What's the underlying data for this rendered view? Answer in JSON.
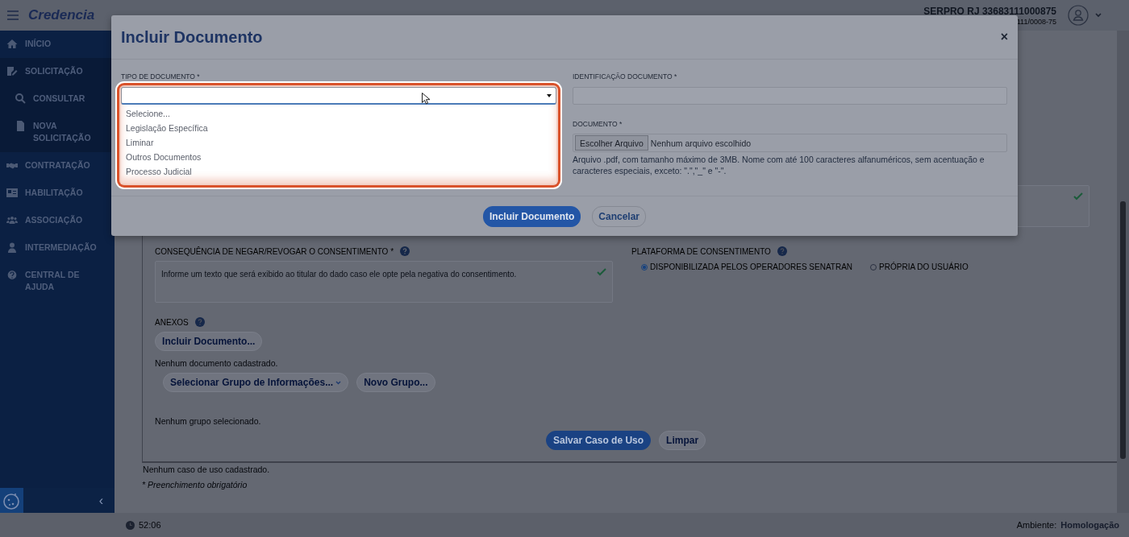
{
  "header": {
    "logo": "Credencia",
    "user_name": "SERPRO RJ 33683111000875",
    "user_sub": "111/0008-75"
  },
  "sidebar": {
    "items": [
      {
        "label": "INÍCIO",
        "expanded": false
      },
      {
        "label": "SOLICITAÇÃO",
        "expanded": true,
        "children": [
          {
            "label": "CONSULTAR"
          },
          {
            "label": "NOVA SOLICITAÇÃO"
          }
        ]
      },
      {
        "label": "CONTRATAÇÃO",
        "expanded": false
      },
      {
        "label": "HABILITAÇÃO",
        "expanded": false
      },
      {
        "label": "ASSOCIAÇÃO",
        "expanded": false
      },
      {
        "label": "INTERMEDIAÇÃO",
        "expanded": false
      },
      {
        "label": "CENTRAL DE AJUDA",
        "expanded": false
      }
    ],
    "collapse": "‹"
  },
  "form": {
    "consequence_label": "CONSEQUÊNCIA DE NEGAR/REVOGAR O CONSENTIMENTO *",
    "consequence_placeholder": "Informe um texto que será exibido ao titular do dado caso ele opte pela negativa do consentimento.",
    "platform_label": "PLATAFORMA DE CONSENTIMENTO",
    "radios": [
      {
        "label": "DISPONIBILIZADA PELOS OPERADORES SENATRAN",
        "selected": true
      },
      {
        "label": "PRÓPRIA DO USUÁRIO",
        "selected": false
      }
    ],
    "attachments_label": "ANEXOS",
    "add_document": "Incluir Documento...",
    "no_documents": "Nenhum documento cadastrado.",
    "select_group": "Selecionar Grupo de Informações...",
    "new_group": "Novo Grupo...",
    "no_group": "Nenhum grupo selecionado.",
    "save": "Salvar Caso de Uso",
    "clear": "Limpar",
    "no_use_case": "Nenhum caso de uso cadastrado.",
    "required_note": "* Preenchimento obrigatório"
  },
  "modal": {
    "title": "Incluir Documento",
    "close": "×",
    "type_label": "TIPO DE DOCUMENTO *",
    "type_open": true,
    "type_options": [
      {
        "label": "Selecione..."
      },
      {
        "label": "Legislação Específica"
      },
      {
        "label": "Liminar"
      },
      {
        "label": "Outros Documentos"
      },
      {
        "label": "Processo Judicial"
      }
    ],
    "id_label": "IDENTIFICAÇÃO DOCUMENTO *",
    "doc_label": "DOCUMENTO *",
    "file_button": "Escolher Arquivo",
    "file_status": "Nenhum arquivo escolhido",
    "file_help": "Arquivo .pdf, com tamanho máximo de 3MB. Nome com até 100 caracteres alfanuméricos, sem acentuação e caracteres especiais, exceto: \".\",\"_\" e \"-\".",
    "submit": "Incluir Documento",
    "cancel": "Cancelar"
  },
  "footer": {
    "timer": "52:06",
    "env_label": "Ambiente:",
    "env_value": "Homologação"
  }
}
